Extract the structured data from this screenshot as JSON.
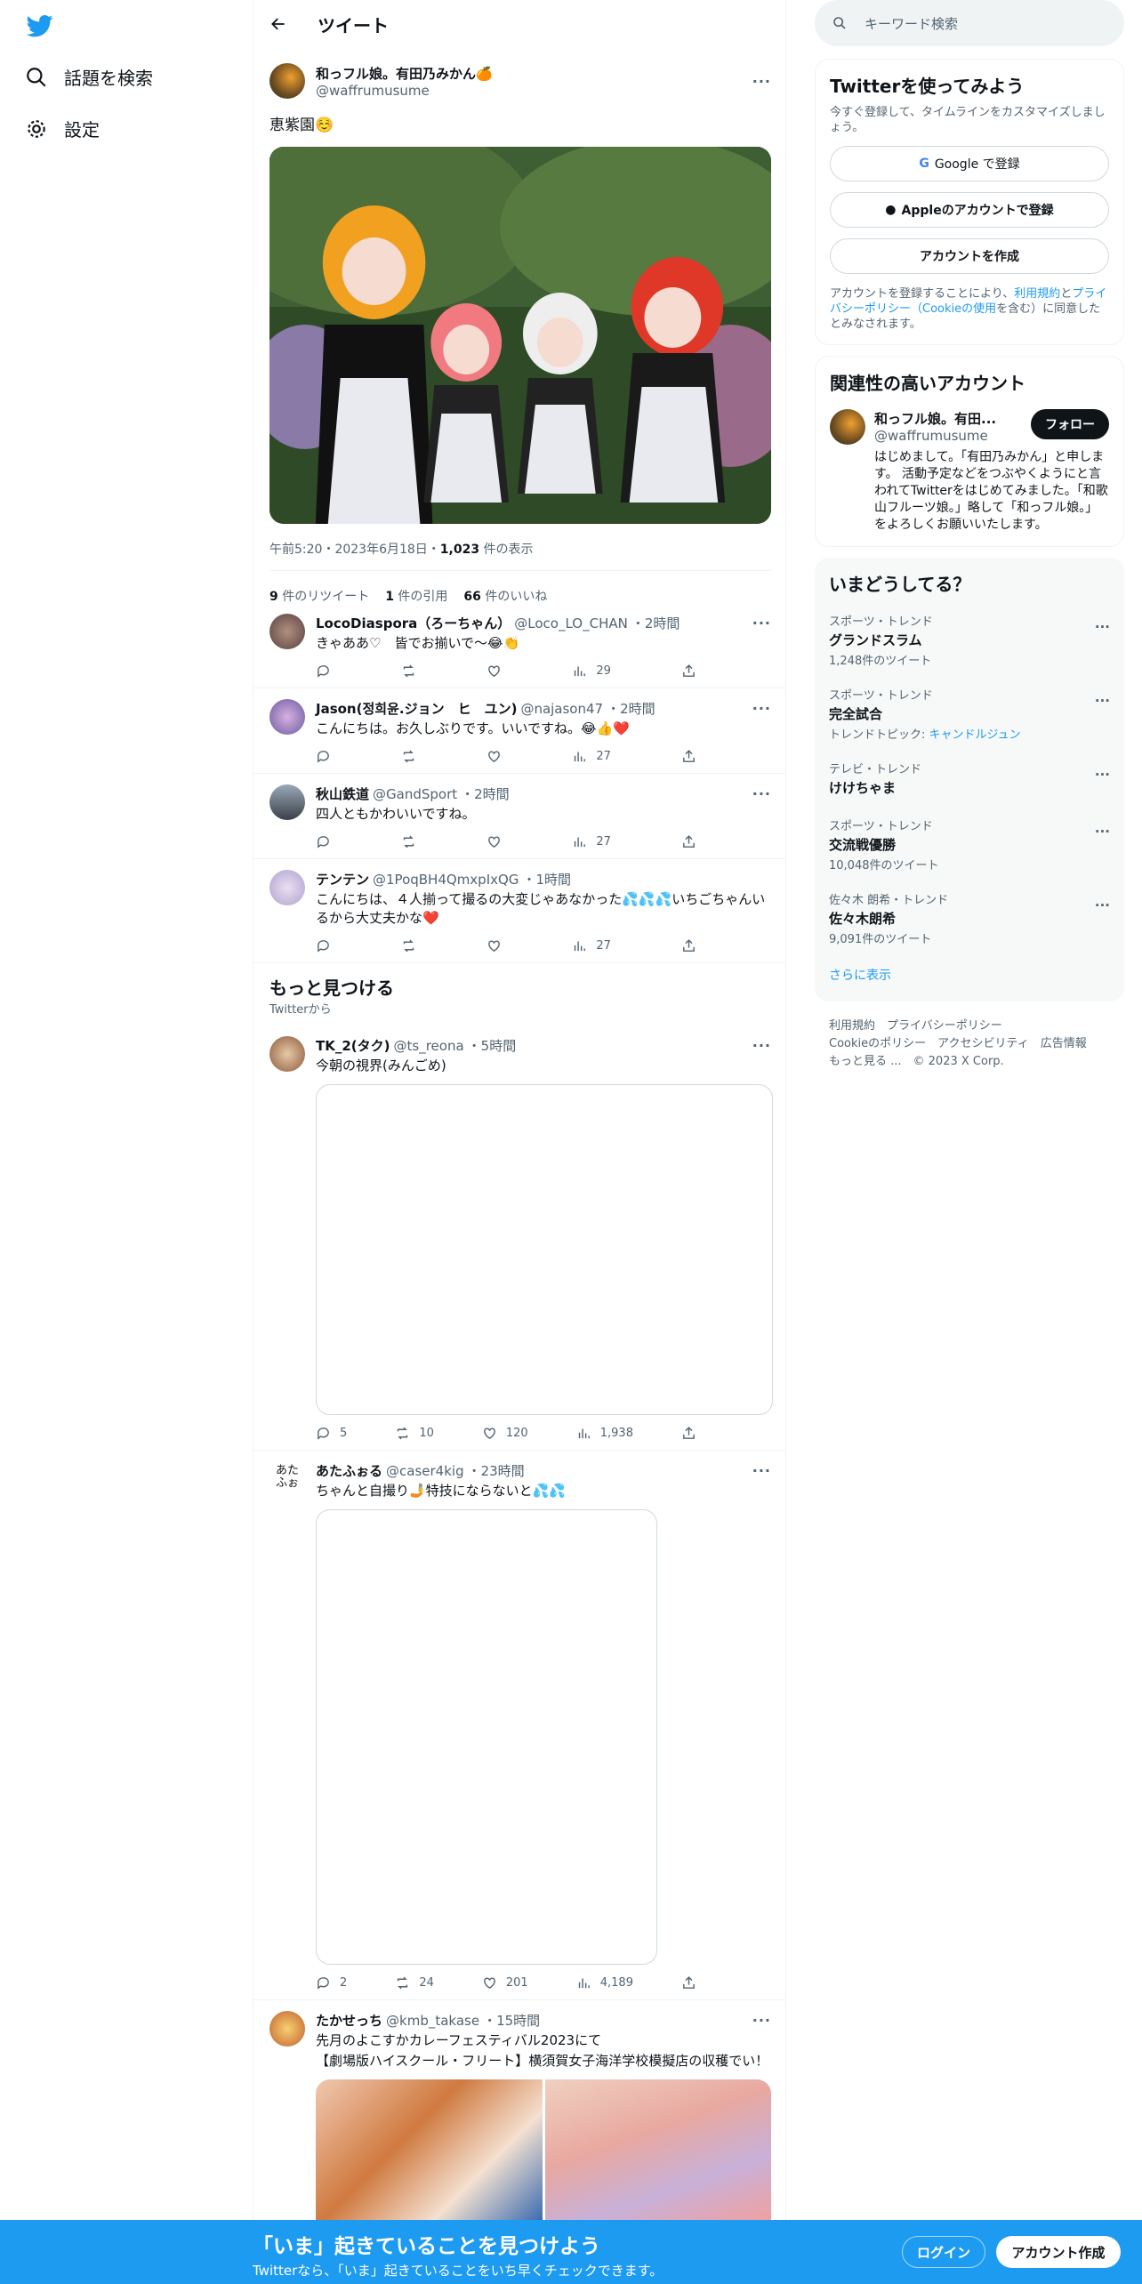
{
  "nav": {
    "explore": "話題を検索",
    "settings": "設定"
  },
  "header": {
    "title": "ツイート"
  },
  "tweet": {
    "name": "和っフル娘。有田乃みかん🍊",
    "handle": "@waffrumusume",
    "text": "恵紫園☺️",
    "time": "午前5:20・2023年6月18日・",
    "views_num": "1,023",
    "views_label": " 件の表示",
    "retweets_num": "9",
    "retweets_label": " 件のリツイート",
    "quotes_num": "1",
    "quotes_label": " 件の引用",
    "likes_num": "66",
    "likes_label": " 件のいいね"
  },
  "replies": [
    {
      "name": "LocoDiaspora（ろーちゃん）",
      "handle": "@Loco_LO_CHAN",
      "time": "・2時間",
      "text": "きゃああ♡　皆でお揃いで～😂👏",
      "views": "29"
    },
    {
      "name": "Jason(정희윤.ジョン　ヒ　ユン)",
      "handle": "@najason47",
      "time": "・2時間",
      "text": "こんにちは。お久しぶりです。いいですね。😂👍❤️",
      "views": "27"
    },
    {
      "name": "秋山鉄道",
      "handle": "@GandSport",
      "time": "・2時間",
      "text": "四人ともかわいいですね。",
      "views": "27"
    },
    {
      "name": "テンテン",
      "handle": "@1PoqBH4QmxpIxQG",
      "time": "・1時間",
      "text": "こんにちは、４人揃って撮るの大変じゃあなかった💦💦💦いちごちゃんいるから大丈夫かな❤️",
      "views": "27"
    }
  ],
  "discover": {
    "title": "もっと見つける",
    "sub": "Twitterから"
  },
  "more": [
    {
      "name": "TK_2(タク)",
      "handle": "@ts_reona",
      "time": "・5時間",
      "text": "今朝の視界(みんごめ)",
      "replies": "5",
      "retweets": "10",
      "likes": "120",
      "views": "1,938"
    },
    {
      "name": "あたふぉる",
      "handle": "@caser4kig",
      "time": "・23時間",
      "text": "ちゃんと自撮り🤳特技にならないと💦💦",
      "replies": "2",
      "retweets": "24",
      "likes": "201",
      "views": "4,189",
      "avatar_text": "あた\nふぉ"
    },
    {
      "name": "たかせっち",
      "handle": "@kmb_takase",
      "time": "・15時間",
      "text": "先月のよこすかカレーフェスティバル2023にて",
      "text2": "【劇場版ハイスクール・フリート】横須賀女子海洋学校模擬店の収穫でい！"
    }
  ],
  "search": {
    "placeholder": "キーワード検索"
  },
  "signup_card": {
    "title": "Twitterを使ってみよう",
    "desc": "今すぐ登録して、タイムラインをカスタマイズしましょう。",
    "google": "Google で登録",
    "apple": "Appleのアカウントで登録",
    "create": "アカウントを作成",
    "legal1": "アカウントを登録することにより、",
    "terms": "利用規約",
    "and": "と",
    "privacy": "プライバシーポリシー（Cookieの使用",
    "legal2": "を含む）に同意したとみなされます。"
  },
  "relevant": {
    "title": "関連性の高いアカウント",
    "name": "和っフル娘。有田...",
    "handle": "@waffrumusume",
    "follow": "フォロー",
    "bio": "はじめまして。「有田乃みかん」と申します。 活動予定などをつぶやくようにと言われてTwitterをはじめてみました。「和歌山フルーツ娘。」略して「和っフル娘。」をよろしくお願いいたします。"
  },
  "trends": {
    "title": "いまどうしてる？",
    "items": [
      {
        "cat": "スポーツ・トレンド",
        "name": "グランドスラム",
        "count": "1,248件のツイート"
      },
      {
        "cat": "スポーツ・トレンド",
        "name": "完全試合",
        "count": "トレンドトピック: ",
        "link": "キャンドルジュン"
      },
      {
        "cat": "テレビ・トレンド",
        "name": "けけちゃま",
        "count": ""
      },
      {
        "cat": "スポーツ・トレンド",
        "name": "交流戦優勝",
        "count": "10,048件のツイート"
      },
      {
        "cat": "佐々木 朗希・トレンド",
        "name": "佐々木朗希",
        "count": "9,091件のツイート"
      }
    ],
    "more": "さらに表示"
  },
  "footer": {
    "l1": "利用規約　プライバシーポリシー",
    "l2": "Cookieのポリシー　アクセシビリティ　広告情報",
    "l3": "もっと見る ...　© 2023 X Corp."
  },
  "bottom": {
    "title": "「いま」起きていることを見つけよう",
    "sub": "Twitterなら、「いま」起きていることをいち早くチェックできます。",
    "login": "ログイン",
    "signup": "アカウント作成"
  },
  "colors": {
    "accent": "#1d9bf0",
    "text": "#0f1419",
    "muted": "#536471"
  }
}
